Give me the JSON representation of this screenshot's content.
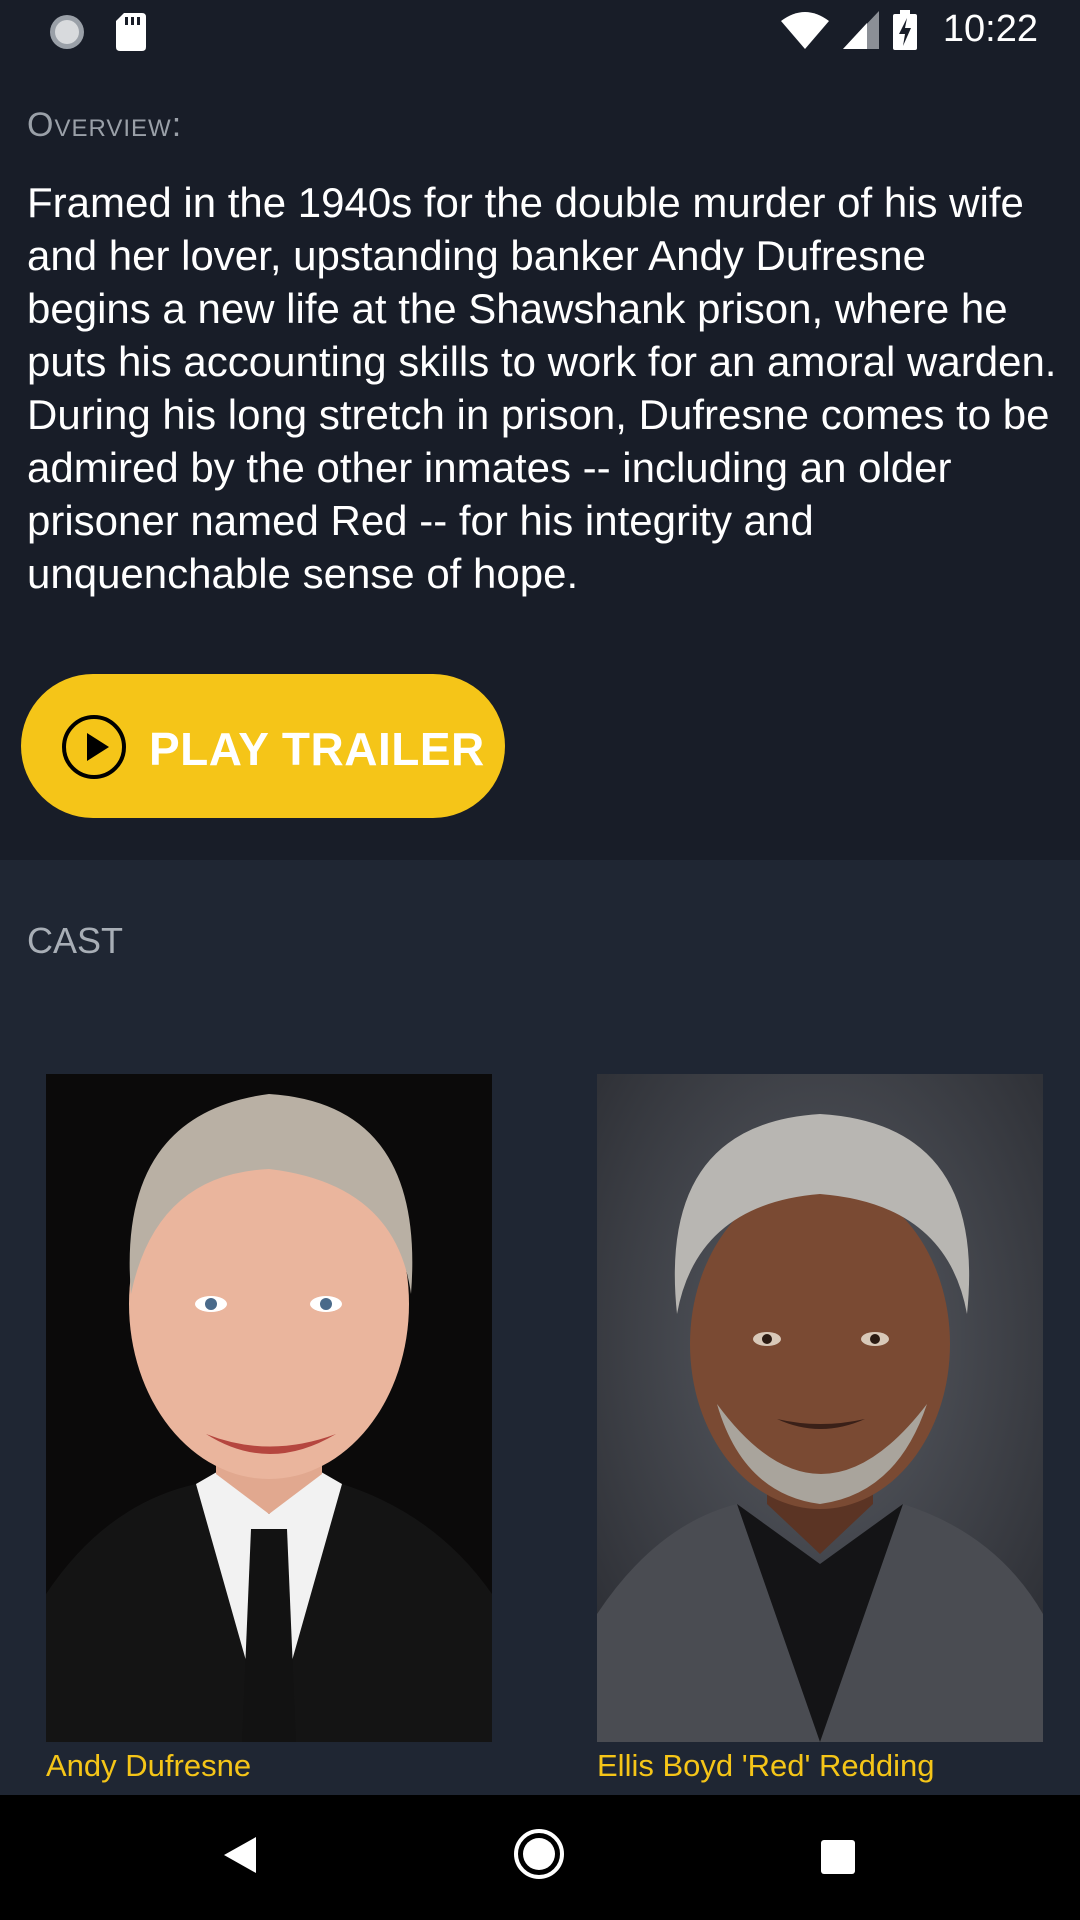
{
  "status_bar": {
    "time": "10:22",
    "icons": [
      "sync-icon",
      "sd-card-icon",
      "wifi-icon",
      "signal-icon",
      "battery-charging-icon"
    ]
  },
  "overview": {
    "label": "Overview:",
    "text": "Framed in the 1940s for the double murder of his wife and her lover, upstanding banker Andy Dufresne begins a new life at the Shawshank prison, where he puts his accounting skills to work for an amoral warden. During his long stretch in prison, Dufresne comes to be admired by the other inmates -- including an older prisoner named Red -- for his integrity and unquenchable sense of hope.",
    "play_button_label": "PLAY TRAILER"
  },
  "cast": {
    "label": "CAST",
    "members": [
      {
        "character": "Andy Dufresne"
      },
      {
        "character": "Ellis Boyd 'Red' Redding"
      }
    ]
  },
  "nav": {
    "icons": [
      "back-icon",
      "home-icon",
      "recents-icon"
    ]
  },
  "colors": {
    "accent": "#f5c518",
    "background": "#181d28",
    "cast_background": "#1f2633"
  }
}
